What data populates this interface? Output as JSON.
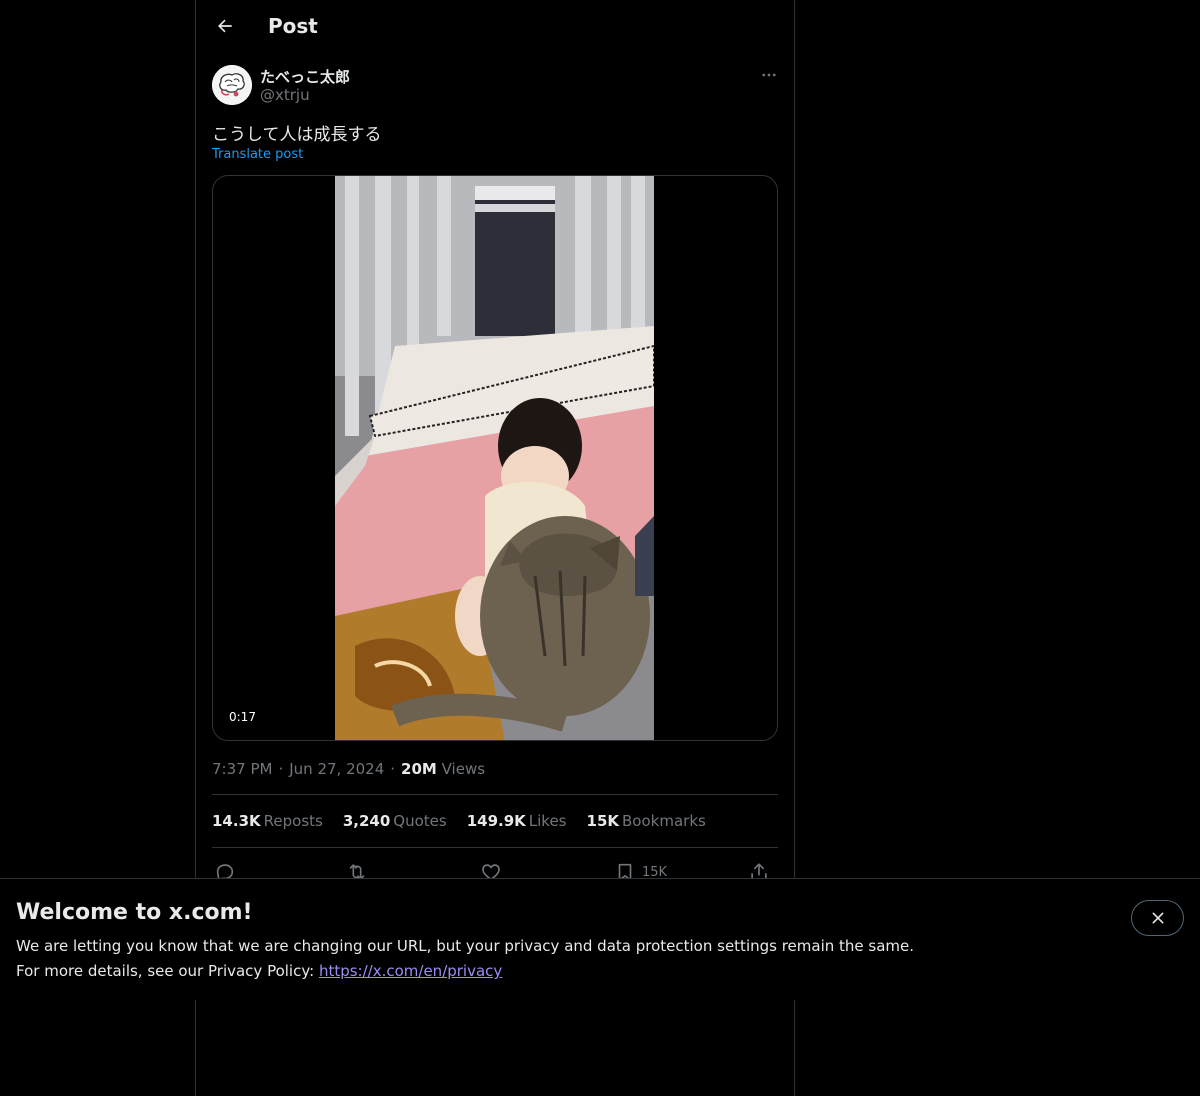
{
  "header": {
    "title": "Post"
  },
  "author": {
    "display_name": "たべっこ太郎",
    "handle": "@xtrju"
  },
  "post": {
    "text": "こうして人は成長する",
    "translate_label": "Translate post",
    "video_duration": "0:17",
    "time": "7:37 PM",
    "date": "Jun 27, 2024",
    "separator": "·",
    "views_count": "20M",
    "views_label": "Views"
  },
  "stats": {
    "reposts_count": "14.3K",
    "reposts_label": "Reposts",
    "quotes_count": "3,240",
    "quotes_label": "Quotes",
    "likes_count": "149.9K",
    "likes_label": "Likes",
    "bookmarks_count": "15K",
    "bookmarks_label": "Bookmarks"
  },
  "actions": {
    "bookmark_count": "15K"
  },
  "banner": {
    "title": "Welcome to x.com!",
    "line1": "We are letting you know that we are changing our URL, but your privacy and data protection settings remain the same.",
    "line2_prefix": "For more details, see our Privacy Policy: ",
    "link": "https://x.com/en/privacy"
  },
  "icons": {
    "back": "arrow-left-icon",
    "more": "more-horizontal-icon",
    "reply": "reply-icon",
    "repost": "repost-icon",
    "like": "heart-icon",
    "bookmark": "bookmark-icon",
    "share": "share-icon",
    "close": "close-icon"
  },
  "colors": {
    "background": "#000000",
    "text": "#e7e9ea",
    "muted": "#71767b",
    "accent": "#1d9bf0",
    "border": "#2f3336",
    "link": "#9b8ef5"
  }
}
